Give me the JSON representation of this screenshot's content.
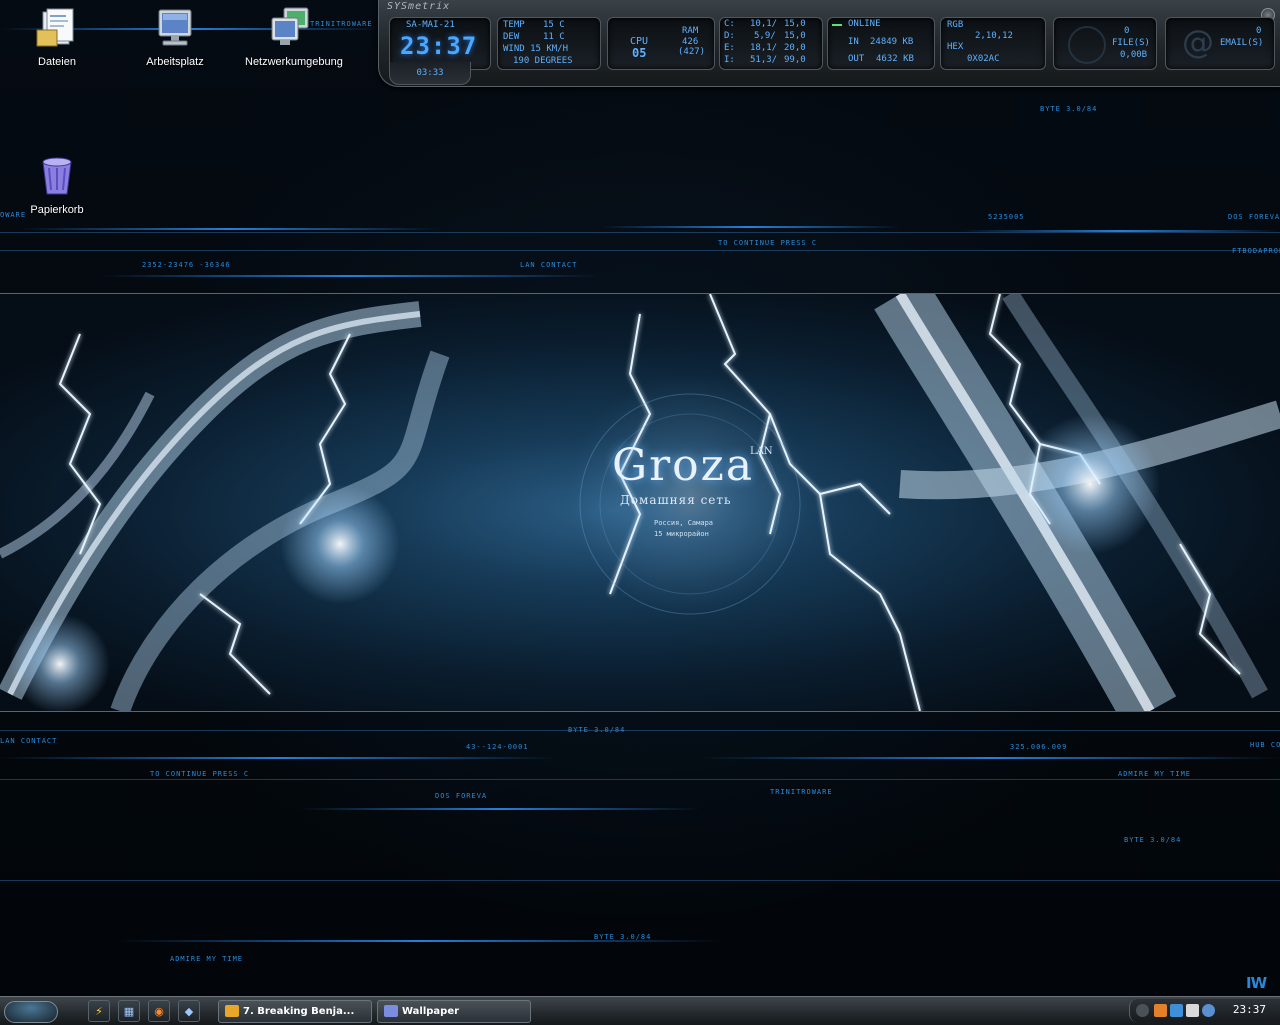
{
  "desktop_icons": [
    {
      "label": "Dateien",
      "icon": "documents-icon"
    },
    {
      "label": "Arbeitsplatz",
      "icon": "my-computer-icon"
    },
    {
      "label": "Netzwerkumgebung",
      "icon": "network-places-icon"
    },
    {
      "label": "Papierkorb",
      "icon": "recycle-bin-icon"
    }
  ],
  "banner": {
    "title": "Groza",
    "title_sup": "LAN",
    "subtitle": "Домашняя сеть",
    "line1": "Россия, Самара",
    "line2": "15 микрорайон"
  },
  "deco_texts": {
    "t1": "TRINITROWARE",
    "t2": "BYTE 3.0/84",
    "t3": "2352-23476 -36346",
    "t4": "LAN CONTACT",
    "t5": "TO CONTINUE PRESS C",
    "t6": "5235005",
    "t7": "DOS FOREVA",
    "t8": "FTBODAPROPERLY",
    "t9": "LAN CONTACT",
    "t10": "43--124-0001",
    "t11": "325.006.009",
    "t12": "TO CONTINUE PRESS C",
    "t13": "ADMIRE MY TIME",
    "t14": "DOS FOREVA",
    "t15": "TRINITROWARE",
    "t16": "HUB CO",
    "t17": "BYTE 3.0/84",
    "t18": "BYTE 3.0/84",
    "t19": "BYTE 3.0/84",
    "t20": "ADMIRE MY TIME",
    "t21": "OWARE"
  },
  "sysmetrix": {
    "title": "SYSmetrix",
    "date": "SA-MAI-21",
    "time_big": "23:37",
    "time_small": "03:33",
    "weather": {
      "temp_label": "TEMP",
      "temp": "15 C",
      "dew_label": "DEW",
      "dew": "11 C",
      "wind": "WIND 15 KM/H",
      "deg": "190 DEGREES"
    },
    "cpu": {
      "label": "CPU",
      "value": "05",
      "ram_label": "RAM",
      "ram_used": "426",
      "ram_total": "(427)"
    },
    "drives": [
      {
        "letter": "C:",
        "used": "10,1/",
        "total": "15,0"
      },
      {
        "letter": "D:",
        "used": "5,9/",
        "total": "15,0"
      },
      {
        "letter": "E:",
        "used": "18,1/",
        "total": "20,0"
      },
      {
        "letter": "I:",
        "used": "51,3/",
        "total": "99,0"
      }
    ],
    "net": {
      "status": "ONLINE",
      "in_label": "IN",
      "in": "24849 KB",
      "out_label": "OUT",
      "out": "4632 KB"
    },
    "color": {
      "rgb_label": "RGB",
      "rgb": "2,10,12",
      "hex_label": "HEX",
      "hex": "0X02AC"
    },
    "files": {
      "count": "0",
      "label": "FILE(S)",
      "size": "0,00B"
    },
    "email": {
      "count": "0",
      "label": "EMAIL(S)"
    }
  },
  "taskbar": {
    "tasks": [
      {
        "label": "7. Breaking Benja..."
      },
      {
        "label": "Wallpaper"
      }
    ],
    "clock": "23:37"
  },
  "watermark": "IW",
  "colors": {
    "accent": "#2a8ad8",
    "glow": "#4aa8ff",
    "led": "#5ce07a"
  }
}
